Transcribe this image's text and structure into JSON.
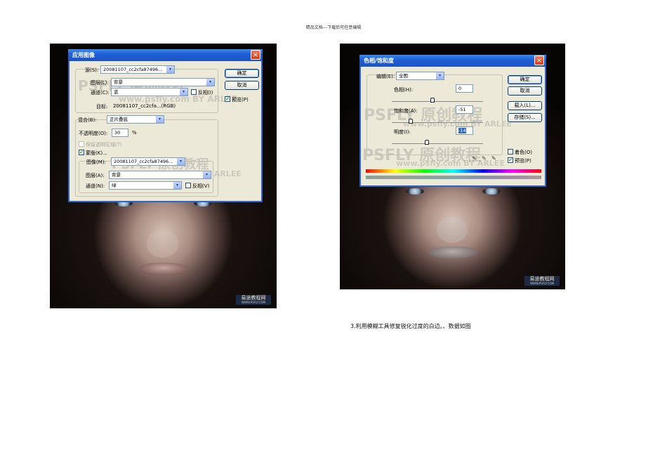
{
  "page": {
    "header": "精品文档---下载后可任意编辑",
    "caption": "3.利用模糊工具修复锐化过度的白边。、数据如图"
  },
  "apply_image": {
    "title": "应用图像",
    "source_label": "源(S):",
    "source_value": "20081107_cc2cfa87496...",
    "layer_label": "图层(L):",
    "layer_value": "背景",
    "channel_label": "通道(C):",
    "channel_value": "蓝",
    "invert_label": "反相(I)",
    "target_label": "目标:",
    "target_value": "20081107_cc2cfa...(RGB)",
    "blend_label": "混合(B):",
    "blend_value": "正片叠底",
    "opacity_label": "不透明度(O):",
    "opacity_value": "30",
    "opacity_unit": "%",
    "preserve_label": "保留透明区域(T)",
    "mask_label": "蒙版(K)...",
    "mask_image_label": "图像(M):",
    "mask_image_value": "20081107_cc2cfa87496...",
    "mask_layer_label": "图层(A):",
    "mask_layer_value": "背景",
    "mask_channel_label": "通道(N):",
    "mask_channel_value": "绿",
    "mask_invert_label": "反相(V)",
    "ok": "确定",
    "cancel": "取消",
    "preview": "预览(P)"
  },
  "hue_sat": {
    "title": "色相/饱和度",
    "edit_label": "编辑(E):",
    "edit_value": "全图",
    "hue_label": "色相(H):",
    "hue_value": "0",
    "sat_label": "饱和度(A):",
    "sat_value": "-51",
    "light_label": "明度(I):",
    "light_value": "-14",
    "ok": "确定",
    "cancel": "取消",
    "load": "载入(L)...",
    "save": "存储(S)...",
    "colorize": "着色(O)",
    "preview": "预览(P)"
  },
  "photos": {
    "badge": "易途教程网",
    "badge_sub": "WWW.PSFLY.COM"
  },
  "watermark": {
    "line1": "PSFLY 原创教程",
    "line2": "www.psfly.com BY ARLEE"
  },
  "colors": {
    "title_bar": "#1f5fd6",
    "dialog_bg": "#ece9d8",
    "close": "#d23c1b"
  }
}
